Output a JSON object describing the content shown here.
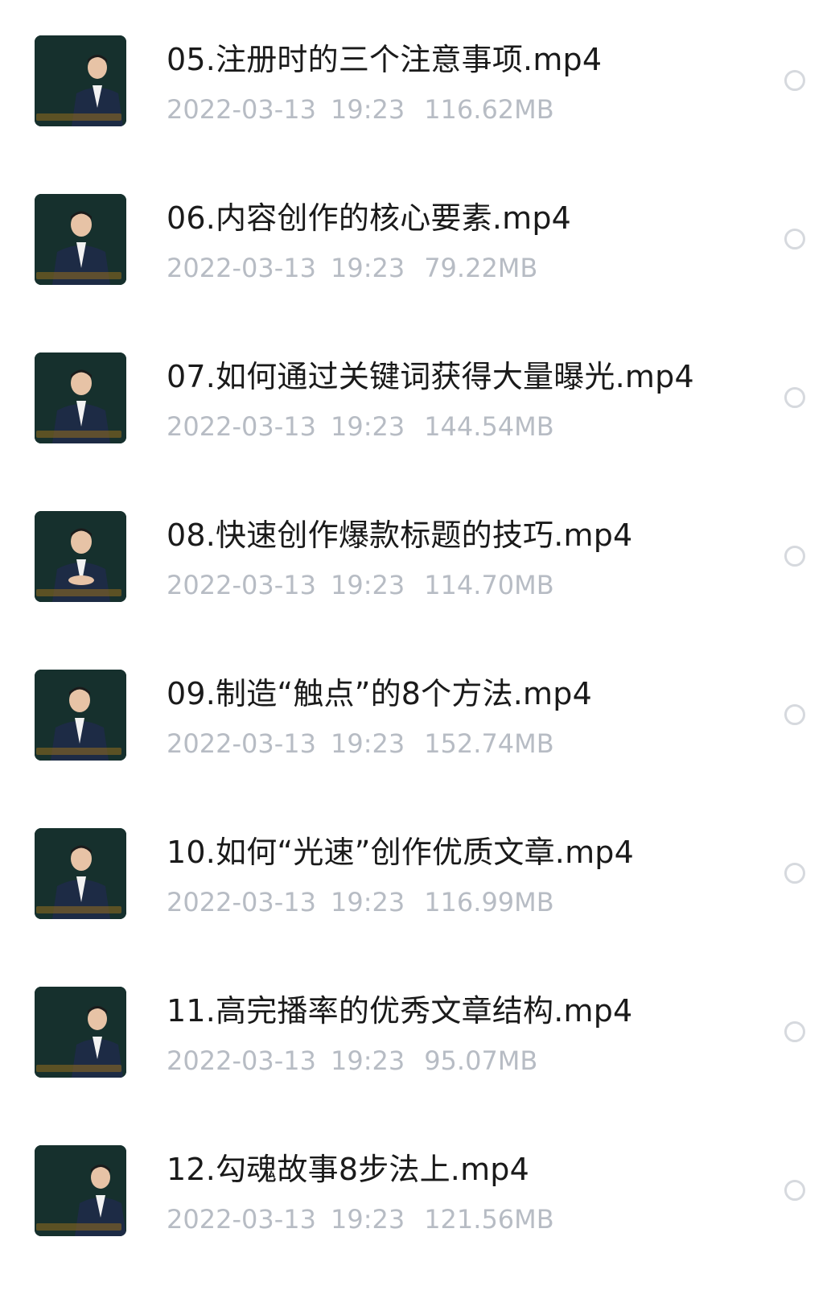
{
  "files": [
    {
      "name": "05.注册时的三个注意事项.mp4",
      "date": "2022-03-13",
      "time": "19:23",
      "size": "116.62MB",
      "thumbnail_icon": "video-thumbnail"
    },
    {
      "name": "06.内容创作的核心要素.mp4",
      "date": "2022-03-13",
      "time": "19:23",
      "size": "79.22MB",
      "thumbnail_icon": "video-thumbnail"
    },
    {
      "name": "07.如何通过关键词获得大量曝光.mp4",
      "date": "2022-03-13",
      "time": "19:23",
      "size": "144.54MB",
      "thumbnail_icon": "video-thumbnail"
    },
    {
      "name": "08.快速创作爆款标题的技巧.mp4",
      "date": "2022-03-13",
      "time": "19:23",
      "size": "114.70MB",
      "thumbnail_icon": "video-thumbnail"
    },
    {
      "name": "09.制造“触点”的8个方法.mp4",
      "date": "2022-03-13",
      "time": "19:23",
      "size": "152.74MB",
      "thumbnail_icon": "video-thumbnail"
    },
    {
      "name": "10.如何“光速”创作优质文章.mp4",
      "date": "2022-03-13",
      "time": "19:23",
      "size": "116.99MB",
      "thumbnail_icon": "video-thumbnail"
    },
    {
      "name": "11.高完播率的优秀文章结构.mp4",
      "date": "2022-03-13",
      "time": "19:23",
      "size": "95.07MB",
      "thumbnail_icon": "video-thumbnail"
    },
    {
      "name": "12.勾魂故事8步法上.mp4",
      "date": "2022-03-13",
      "time": "19:23",
      "size": "121.56MB",
      "thumbnail_icon": "video-thumbnail"
    }
  ],
  "colors": {
    "name_text": "#1a1a1a",
    "meta_text": "#b7bcc4",
    "radio_border": "#d6d9de",
    "thumbnail_bg": "#16302d"
  }
}
